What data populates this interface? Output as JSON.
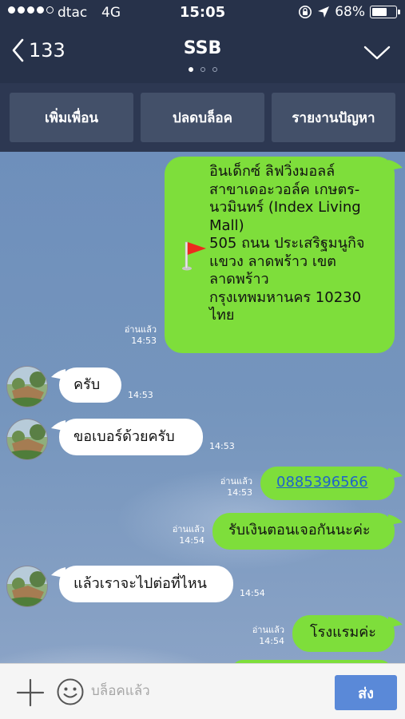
{
  "status_bar": {
    "carrier": "dtac",
    "network": "4G",
    "time": "15:05",
    "battery_pct": "68%",
    "battery_level": 0.68,
    "signal_bars_filled": 4,
    "icons": [
      "signal-dots-icon",
      "rotation-lock-icon",
      "location-arrow-icon",
      "battery-icon"
    ]
  },
  "header": {
    "back_count": "133",
    "title": "SSB",
    "page_dots": 3,
    "active_dot": 0
  },
  "actions": {
    "add_friend": "เพิ่มเพื่อน",
    "unblock": "ปลดบล็อค",
    "report": "รายงานปัญหา"
  },
  "messages": [
    {
      "direction": "out",
      "type": "location",
      "lines": [
        "อินเด็กซ์ ลิฟวิ่งมอลล์",
        "สาขาเดอะวอล์ค เกษตร-",
        "นวมินทร์ (Index Living",
        "Mall)",
        "505 ถนน ประเสริฐมนูกิจ",
        "แขวง ลาดพร้าว เขต",
        "ลาดพร้าว",
        "กรุงเทพมหานคร 10230",
        "ไทย"
      ],
      "read": "อ่านแล้ว",
      "time": "14:53"
    },
    {
      "direction": "in",
      "text": "ครับ",
      "time": "14:53"
    },
    {
      "direction": "in",
      "text": "ขอเบอร์ด้วยครับ",
      "time": "14:53"
    },
    {
      "direction": "out",
      "text": "0885396566",
      "is_link": true,
      "read": "อ่านแล้ว",
      "time": "14:53"
    },
    {
      "direction": "out",
      "text": "รับเงินตอนเจอกันนะค่ะ",
      "read": "อ่านแล้ว",
      "time": "14:54"
    },
    {
      "direction": "in",
      "text": "แล้วเราจะไปต่อที่ไหน",
      "time": "14:54"
    },
    {
      "direction": "out",
      "text": "โรงแรมค่ะ",
      "read": "อ่านแล้ว",
      "time": "14:54"
    }
  ],
  "input_bar": {
    "placeholder": "บล็อคแล้ว",
    "send_label": "ส่ง"
  },
  "colors": {
    "header_bg": "#27324a",
    "action_bar_bg": "#2d3852",
    "action_button_bg": "#435069",
    "outgoing_bubble": "#7ede3b",
    "incoming_bubble": "#ffffff",
    "link": "#1f63c9",
    "send_button": "#5a89d8"
  }
}
